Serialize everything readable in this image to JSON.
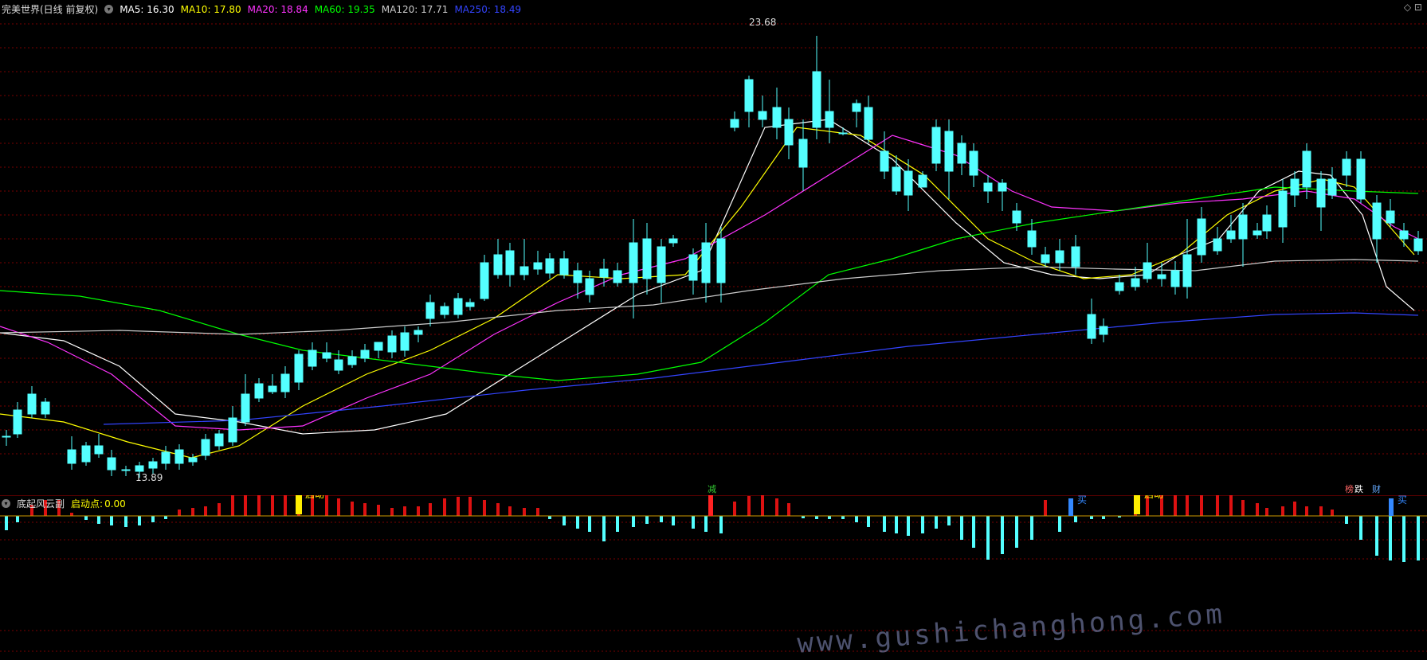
{
  "header": {
    "stock_name": "完美世界(日线 前复权)",
    "ma_labels": [
      {
        "text": "MA5: 16.30",
        "color": "#ffffff"
      },
      {
        "text": "MA10: 17.80",
        "color": "#ffff00"
      },
      {
        "text": "MA20: 18.84",
        "color": "#ff33ff"
      },
      {
        "text": "MA60: 19.35",
        "color": "#00ff00"
      },
      {
        "text": "MA120: 17.71",
        "color": "#cccccc"
      },
      {
        "text": "MA250: 18.49",
        "color": "#3344ff"
      }
    ],
    "top_right_icons": "◇ ⊡"
  },
  "main": {
    "high_label": "23.68",
    "low_label": "13.89",
    "markers": [
      {
        "text": "减",
        "color": "#33cc33"
      },
      {
        "text": "榜",
        "color": "#ff6666"
      },
      {
        "text": "跌",
        "color": "#ffffff"
      },
      {
        "text": "财",
        "color": "#66aaff"
      }
    ]
  },
  "sub": {
    "title": "底起风云副",
    "param_label": "启动点:",
    "param_value": "0.00",
    "annotations": {
      "qidong": "启动",
      "zhidie": "止跌见底",
      "gongzhen": "共振信号",
      "mai": "买"
    },
    "watermark": "www.gushichanghong.com"
  },
  "colors": {
    "up": "#ff3333",
    "down": "#54ffff",
    "grid": "#7a0000",
    "ma5": "#ffffff",
    "ma10": "#ffff00",
    "ma20": "#ff33ff",
    "ma60": "#00ff00",
    "ma120": "#cccccc",
    "ma250": "#3344ff"
  }
}
